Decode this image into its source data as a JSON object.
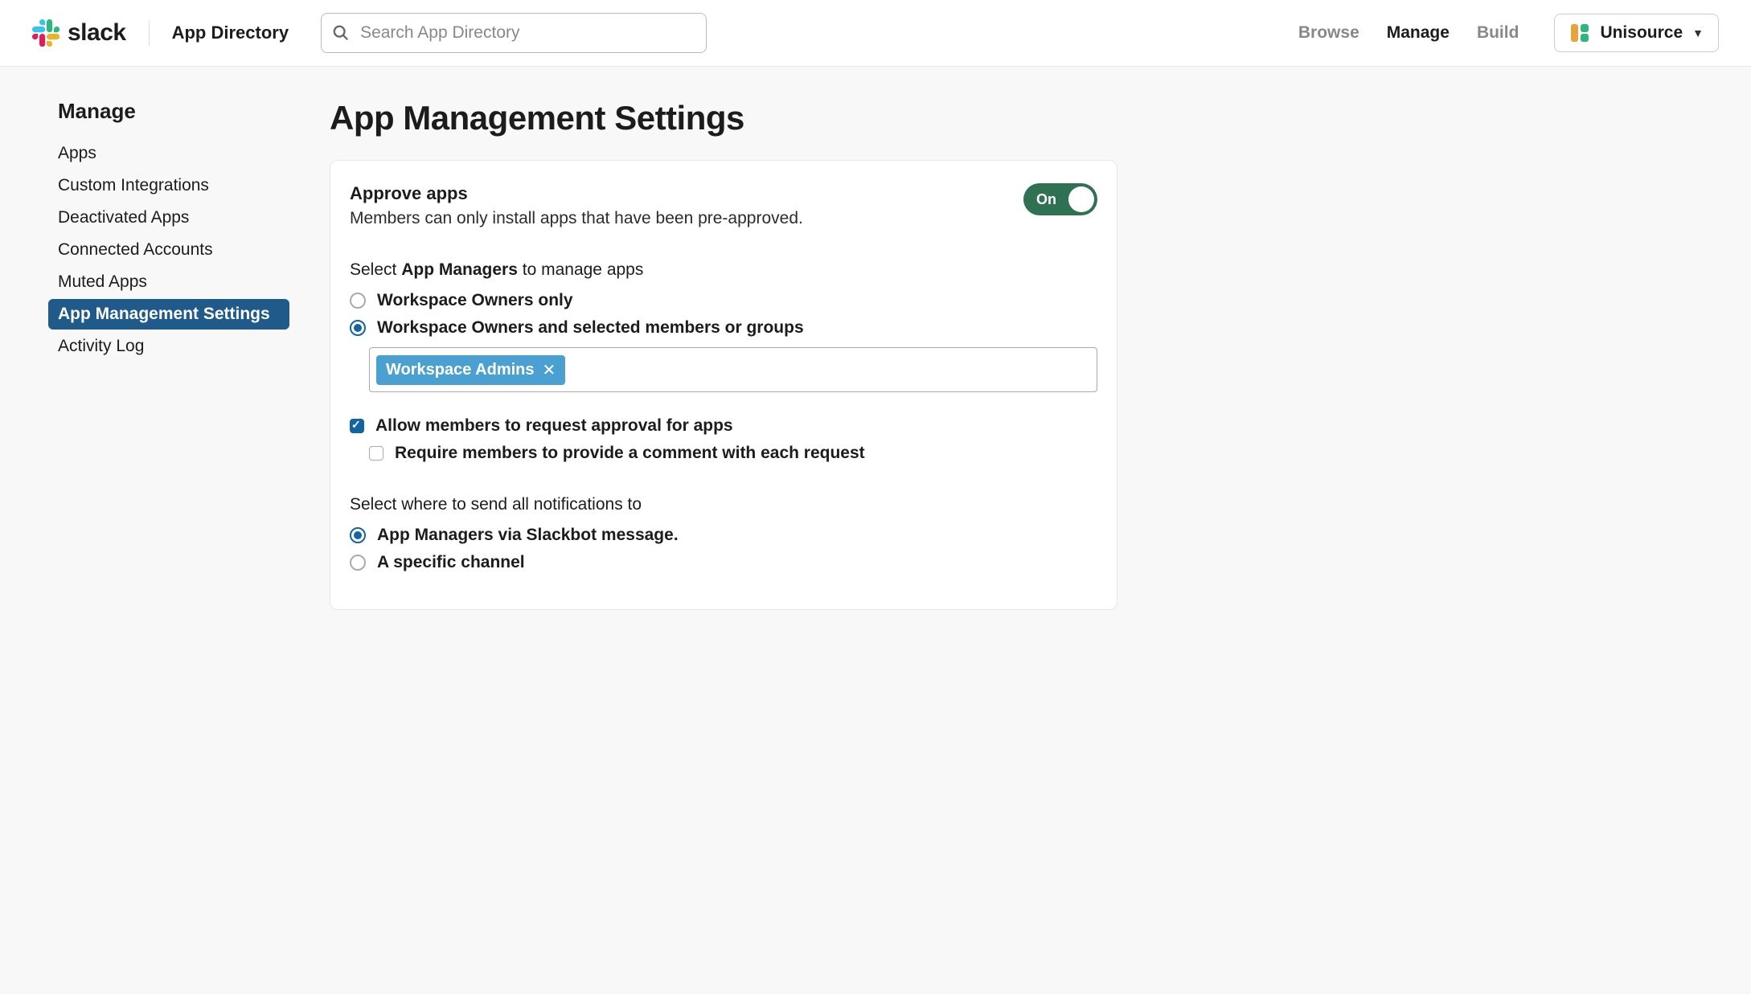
{
  "header": {
    "brand": "slack",
    "app_directory_label": "App Directory",
    "search_placeholder": "Search App Directory",
    "nav": {
      "browse": "Browse",
      "manage": "Manage",
      "build": "Build"
    },
    "workspace_name": "Unisource"
  },
  "sidebar": {
    "title": "Manage",
    "items": [
      {
        "label": "Apps",
        "selected": false
      },
      {
        "label": "Custom Integrations",
        "selected": false
      },
      {
        "label": "Deactivated Apps",
        "selected": false
      },
      {
        "label": "Connected Accounts",
        "selected": false
      },
      {
        "label": "Muted Apps",
        "selected": false
      },
      {
        "label": "App Management Settings",
        "selected": true
      },
      {
        "label": "Activity Log",
        "selected": false
      }
    ]
  },
  "main": {
    "title": "App Management Settings",
    "approve": {
      "title": "Approve apps",
      "desc": "Members can only install apps that have been pre-approved.",
      "toggle_label": "On"
    },
    "managers": {
      "prompt_prefix": "Select ",
      "prompt_bold": "App Managers",
      "prompt_suffix": " to manage apps",
      "option1": "Workspace Owners only",
      "option2": "Workspace Owners and selected members or groups",
      "token": "Workspace Admins"
    },
    "requests": {
      "allow_label": "Allow members to request approval for apps",
      "require_comment_label": "Require members to provide a comment with each request"
    },
    "notifications": {
      "prompt": "Select where to send all notifications to",
      "option1": "App Managers via Slackbot message.",
      "option2": "A specific channel"
    }
  }
}
